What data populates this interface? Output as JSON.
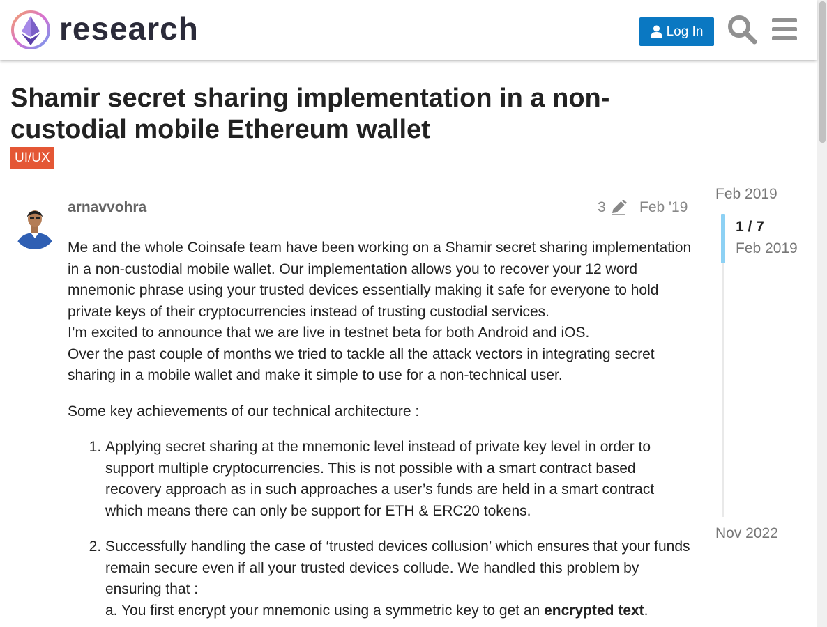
{
  "header": {
    "site_name": "research",
    "login_label": "Log In"
  },
  "topic": {
    "title": "Shamir secret sharing implementation in a non-custodial mobile Ethereum wallet",
    "category": "UI/UX"
  },
  "post": {
    "username": "arnavvohra",
    "edit_count": "3",
    "date": "Feb '19",
    "para1": "Me and the whole Coinsafe team have been working on a Shamir secret sharing implementation in a non-custodial mobile wallet. Our implementation allows you to recover your 12 word mnemonic phrase using your trusted devices essentially making it safe for everyone to hold private keys of their cryptocurrencies instead of trusting custodial services.",
    "para2": "I’m excited to announce that we are live in testnet beta for both Android and iOS.",
    "para3": "Over the past couple of months we tried to tackle all the attack vectors in integrating secret sharing in a mobile wallet and make it simple to use for a non-technical user.",
    "para4": "Some key achievements of our technical architecture :",
    "list": [
      "Applying secret sharing at the mnemonic level instead of private key level in order to support multiple cryptocurrencies. This is not possible with a smart contract based recovery approach as in such approaches a user’s funds are held in a smart contract which means there can only be support for ETH & ERC20 tokens.",
      "Successfully handling the case of ‘trusted devices collusion’ which ensures that your funds remain secure even if all your trusted devices collude. We handled this problem by ensuring that :"
    ],
    "sub_a_prefix": "a. You first encrypt your mnemonic using a symmetric key to get an ",
    "sub_a_bold": "encrypted text",
    "sub_a_suffix": "."
  },
  "timeline": {
    "start_date": "Feb 2019",
    "position": "1 / 7",
    "position_date": "Feb 2019",
    "end_date": "Nov 2022"
  },
  "colors": {
    "accent": "#0a78c2",
    "category": "#e45735",
    "timeline_handle": "#8dd1f4"
  },
  "icons": [
    "logo-icon",
    "user-icon",
    "search-icon",
    "hamburger-menu-icon",
    "pencil-icon",
    "avatar"
  ]
}
